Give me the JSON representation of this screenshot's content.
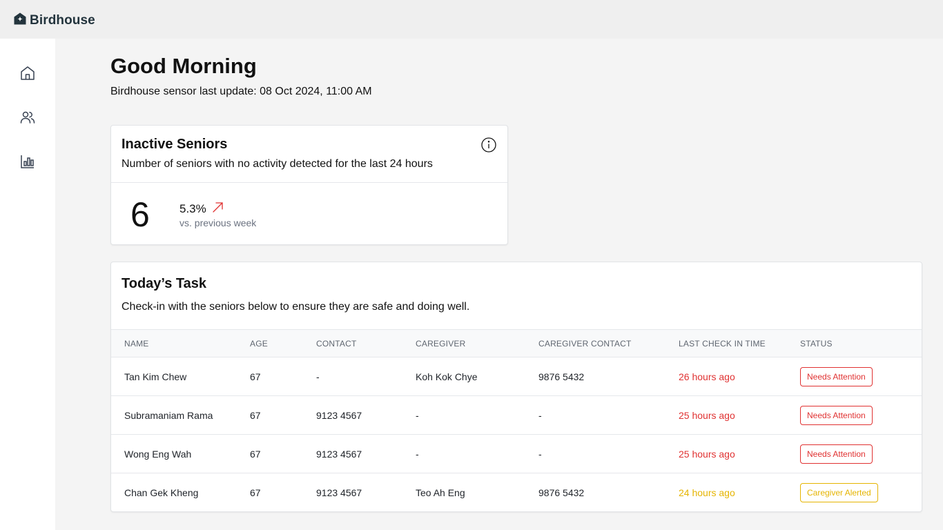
{
  "app": {
    "name": "Birdhouse",
    "logo_icon": "house-icon"
  },
  "sidebar": {
    "items": [
      {
        "icon": "home-icon"
      },
      {
        "icon": "users-icon"
      },
      {
        "icon": "bar-chart-icon"
      }
    ]
  },
  "header": {
    "greeting": "Good Morning",
    "last_update": "Birdhouse sensor last update: 08 Oct 2024, 11:00 AM"
  },
  "inactive_card": {
    "title": "Inactive Seniors",
    "description": "Number of seniors with no activity detected for the last 24 hours",
    "count": "6",
    "change": "5.3%",
    "change_direction": "up",
    "change_color": "#e03131",
    "comparison": "vs. previous week",
    "info_icon": "info-icon"
  },
  "tasks_card": {
    "title": "Today’s Task",
    "description": "Check-in with the seniors below to ensure they are safe and doing well.",
    "columns": [
      "NAME",
      "AGE",
      "CONTACT",
      "CAREGIVER",
      "CAREGIVER CONTACT",
      "LAST CHECK IN TIME",
      "STATUS"
    ],
    "rows": [
      {
        "name": "Tan Kim Chew",
        "age": "67",
        "contact": "-",
        "caregiver": "Koh Kok Chye",
        "caregiver_contact": "9876 5432",
        "last_check_in": "26 hours ago",
        "status": "Needs Attention",
        "severity": "red"
      },
      {
        "name": "Subramaniam Rama",
        "age": "67",
        "contact": "9123 4567",
        "caregiver": "-",
        "caregiver_contact": "-",
        "last_check_in": "25 hours ago",
        "status": "Needs Attention",
        "severity": "red"
      },
      {
        "name": "Wong Eng Wah",
        "age": "67",
        "contact": "9123 4567",
        "caregiver": "-",
        "caregiver_contact": "-",
        "last_check_in": "25 hours ago",
        "status": "Needs Attention",
        "severity": "red"
      },
      {
        "name": "Chan Gek Kheng",
        "age": "67",
        "contact": "9123 4567",
        "caregiver": "Teo Ah Eng",
        "caregiver_contact": "9876 5432",
        "last_check_in": "24 hours ago",
        "status": "Caregiver Alerted",
        "severity": "amber"
      }
    ]
  },
  "colors": {
    "alert_red": "#e03131",
    "alert_amber": "#e5b400",
    "brand": "#23343d"
  }
}
